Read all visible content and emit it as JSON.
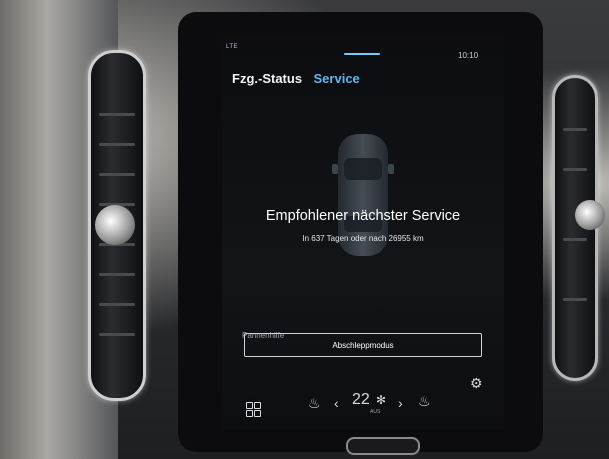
{
  "status_bar": {
    "network": "LTE",
    "time": "10:10"
  },
  "tabs": [
    {
      "label": "Fzg.-Status",
      "active": false
    },
    {
      "label": "Service",
      "active": true
    }
  ],
  "service": {
    "headline": "Empfohlener nächster Service",
    "detail": "In 637 Tagen oder nach 26955 km"
  },
  "assistance": {
    "label": "Pannenhilfe",
    "tow_button_label": "Abschleppmodus"
  },
  "climate_bar": {
    "temperature": "22",
    "fan_mode": "AUS",
    "icons": [
      "apps-grid-icon",
      "seat-heater-left-icon",
      "chevron-left-icon",
      "fan-icon",
      "chevron-right-icon",
      "seat-heater-right-icon",
      "gear-icon"
    ]
  },
  "colors": {
    "accent": "#5eb6ee",
    "screen_bg": "#0f1114",
    "text": "#ffffff"
  }
}
